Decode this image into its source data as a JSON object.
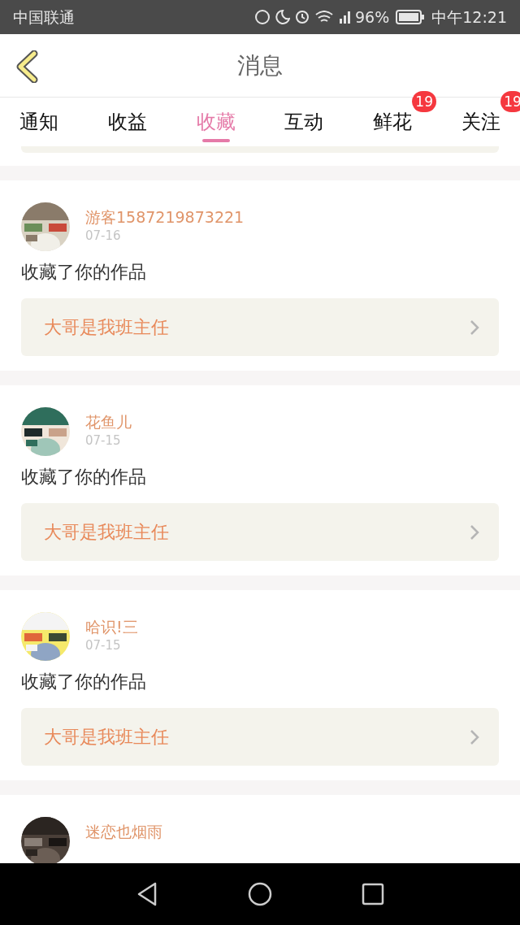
{
  "status_bar": {
    "carrier": "中国联通",
    "battery": "96%",
    "time": "中午12:21"
  },
  "header": {
    "title": "消息"
  },
  "tabs": [
    {
      "label": "通知",
      "selected": false
    },
    {
      "label": "收益",
      "selected": false
    },
    {
      "label": "收藏",
      "selected": true
    },
    {
      "label": "互动",
      "selected": false
    },
    {
      "label": "鲜花",
      "selected": false,
      "badge": "19"
    },
    {
      "label": "关注",
      "selected": false,
      "badge": "19"
    }
  ],
  "messages": [
    {
      "name": "游客1587219873221",
      "date": "07-16",
      "action": "收藏了你的作品",
      "work": "大哥是我班主任"
    },
    {
      "name": "花鱼儿",
      "date": "07-15",
      "action": "收藏了你的作品",
      "work": "大哥是我班主任"
    },
    {
      "name": "哈识!三",
      "date": "07-15",
      "action": "收藏了你的作品",
      "work": "大哥是我班主任"
    },
    {
      "name": "迷恋也烟雨"
    }
  ]
}
